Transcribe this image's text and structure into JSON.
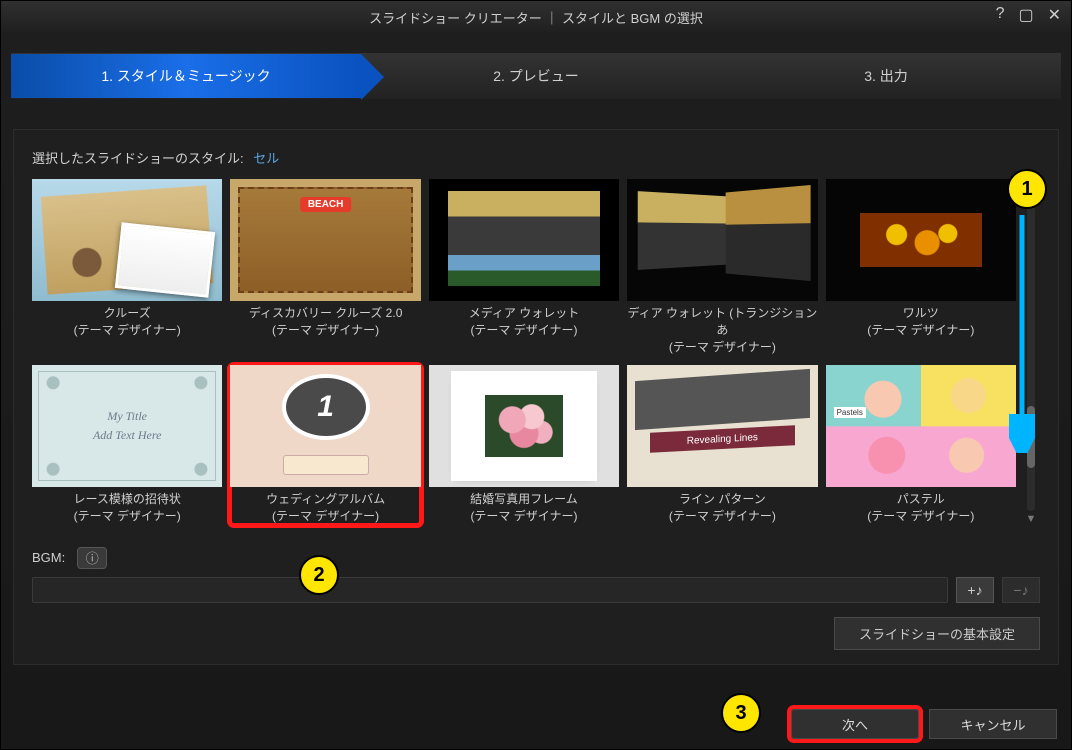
{
  "title": "スライドショー クリエーター  ｜  スタイルと BGM の選択",
  "steps": {
    "s1": "1. スタイル＆ミュージック",
    "s2": "2. プレビュー",
    "s3": "3. 出力"
  },
  "selected": {
    "label": "選択したスライドショーのスタイル:",
    "value": "セル"
  },
  "tiles": [
    {
      "name": "クルーズ",
      "sub": "(テーマ デザイナー)"
    },
    {
      "name": "ディスカバリー クルーズ 2.0",
      "sub": "(テーマ デザイナー)"
    },
    {
      "name": "メディア ウォレット",
      "sub": "(テーマ デザイナー)"
    },
    {
      "name": "ディア ウォレット (トランジションあ",
      "sub": "(テーマ デザイナー)"
    },
    {
      "name": "ワルツ",
      "sub": "(テーマ デザイナー)"
    },
    {
      "name": "レース模様の招待状",
      "sub": "(テーマ デザイナー)"
    },
    {
      "name": "ウェディングアルバム",
      "sub": "(テーマ デザイナー)"
    },
    {
      "name": "結婚写真用フレーム",
      "sub": "(テーマ デザイナー)"
    },
    {
      "name": "ライン パターン",
      "sub": "(テーマ デザイナー)"
    },
    {
      "name": "パステル",
      "sub": "(テーマ デザイナー)"
    }
  ],
  "bgm": {
    "label": "BGM:",
    "add": "+♪",
    "remove": "−♪"
  },
  "prefs_link": "スライドショーの基本設定",
  "footer": {
    "next": "次へ",
    "cancel": "キャンセル"
  },
  "annotations": {
    "b1": "1",
    "b2": "2",
    "b3": "3"
  },
  "pastel_tag": "Pastels"
}
